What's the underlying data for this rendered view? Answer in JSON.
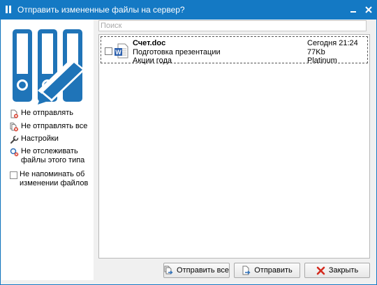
{
  "window": {
    "title": "Отправить измененные файлы на сервер?"
  },
  "sidebar": {
    "actions": [
      {
        "label": "Не отправлять",
        "icon": "doc-cancel-icon"
      },
      {
        "label": "Не отправлять все",
        "icon": "docs-cancel-icon"
      },
      {
        "label": "Настройки",
        "icon": "wrench-icon"
      },
      {
        "label": "Не отслеживать\nфайлы этого типа",
        "icon": "magnifier-cancel-icon"
      }
    ],
    "reminder_checkbox": {
      "label": "Не напоминать об\nизменении файлов",
      "checked": false
    }
  },
  "search": {
    "placeholder": "Поиск",
    "value": ""
  },
  "files": [
    {
      "name": "Счет.doc",
      "description": "Подготовка презентации",
      "tag": "Акции года",
      "modified": "Сегодня 21:24",
      "size": "77Kb",
      "owner": "Platinum",
      "checked": false,
      "icon": "word-doc-icon"
    }
  ],
  "buttons": {
    "send_all": "Отправить все",
    "send": "Отправить",
    "close": "Закрыть"
  },
  "colors": {
    "title_bar": "#1479c4",
    "logo_blue": "#1f74b8",
    "close_x": "#d42a1e"
  }
}
